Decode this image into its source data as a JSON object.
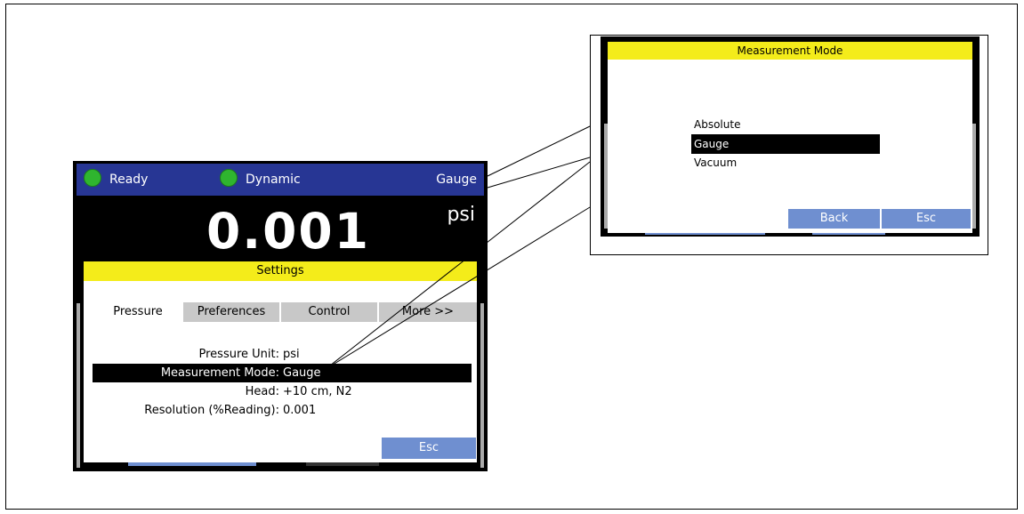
{
  "device": {
    "status": {
      "ready_label": "Ready",
      "mode_label": "Dynamic",
      "measurement_label": "Gauge"
    },
    "reading": {
      "value": "0.001",
      "unit": "psi"
    },
    "colors": {
      "status_bar": "#273694",
      "title_bar": "#f4ec1a",
      "button": "#6f8fd0",
      "indicator": "#2fb52f"
    }
  },
  "settings": {
    "title": "Settings",
    "tabs": [
      {
        "label": "Pressure"
      },
      {
        "label": "Preferences"
      },
      {
        "label": "Control"
      },
      {
        "label": "More >>"
      }
    ],
    "rows": [
      {
        "label": "Pressure Unit:",
        "value": "psi"
      },
      {
        "label": "Measurement Mode:",
        "value": "Gauge"
      },
      {
        "label": "Head:",
        "value": "+10 cm, N2"
      },
      {
        "label": "Resolution (%Reading):",
        "value": "0.001"
      }
    ],
    "esc_label": "Esc"
  },
  "measurement_mode": {
    "title": "Measurement Mode",
    "options": [
      {
        "label": "Absolute"
      },
      {
        "label": "Gauge"
      },
      {
        "label": "Vacuum"
      }
    ],
    "back_label": "Back",
    "esc_label": "Esc"
  }
}
